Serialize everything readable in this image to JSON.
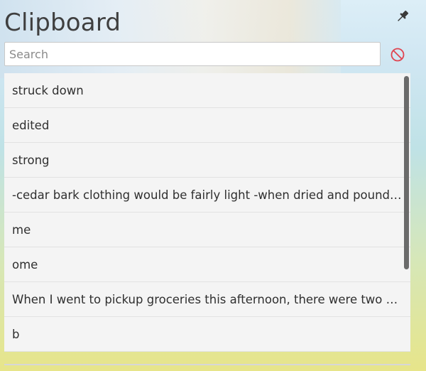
{
  "window": {
    "title": "Clipboard"
  },
  "search": {
    "placeholder": "Search",
    "value": ""
  },
  "icons": {
    "pin": "pin-icon",
    "clear": "clear-history-icon"
  },
  "colors": {
    "clear_icon": "#e0434f",
    "text": "#2f2f2f",
    "list_bg": "#f4f4f4",
    "scrollbar_thumb": "#6b6b6b"
  },
  "items": [
    {
      "text": "struck down"
    },
    {
      "text": "edited"
    },
    {
      "text": "strong"
    },
    {
      "text": "-cedar bark clothing would be fairly light -when dried and pounded..."
    },
    {
      "text": "me"
    },
    {
      "text": "ome"
    },
    {
      "text": "When I went to pickup groceries this afternoon, there were two gro..."
    },
    {
      "text": "b"
    }
  ]
}
